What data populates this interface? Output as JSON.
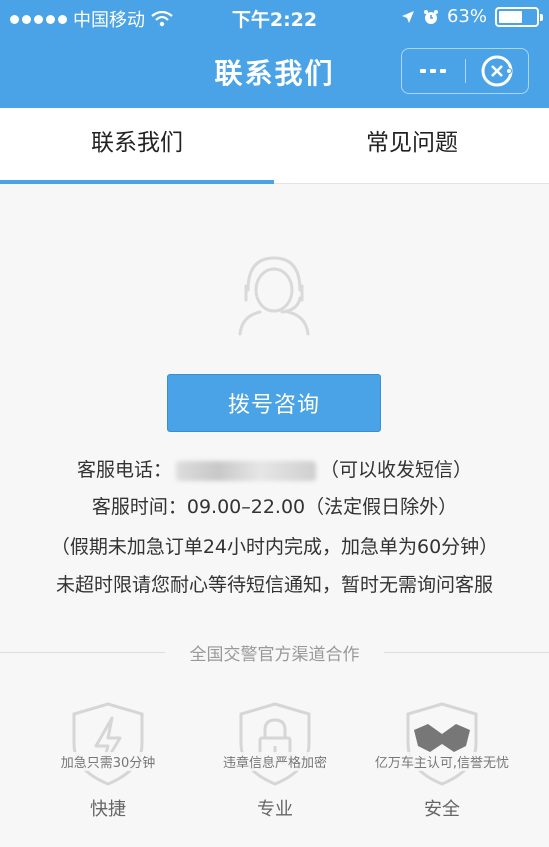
{
  "status_bar": {
    "carrier": "中国移动",
    "time": "下午2:22",
    "battery": "63%",
    "battery_level": 0.63
  },
  "navbar": {
    "title": "联系我们"
  },
  "tabs": [
    {
      "label": "联系我们",
      "active": true
    },
    {
      "label": "常见问题",
      "active": false
    }
  ],
  "contact": {
    "dial_button": "拨号咨询",
    "phone_label": "客服电话：",
    "phone_note": "（可以收发短信）",
    "hours_label": "客服时间：",
    "hours_value": "09.00–22.00（法定假日除外）",
    "notice_line1": "（假期未加急订单24小时内完成，加急单为60分钟）",
    "notice_line2": "未超时限请您耐心等待短信通知，暂时无需询问客服"
  },
  "partner_divider": "全国交警官方渠道合作",
  "features": [
    {
      "icon": "lightning-icon",
      "desc": "加急只需30分钟",
      "name": "快捷"
    },
    {
      "icon": "lock-icon",
      "desc": "违章信息严格加密",
      "name": "专业"
    },
    {
      "icon": "handshake-icon",
      "desc": "亿万车主认可,信誉无忧",
      "name": "安全"
    }
  ],
  "colors": {
    "primary": "#4aa3e6",
    "background": "#f7f7f7",
    "icon_gray": "#d6d6d6"
  }
}
